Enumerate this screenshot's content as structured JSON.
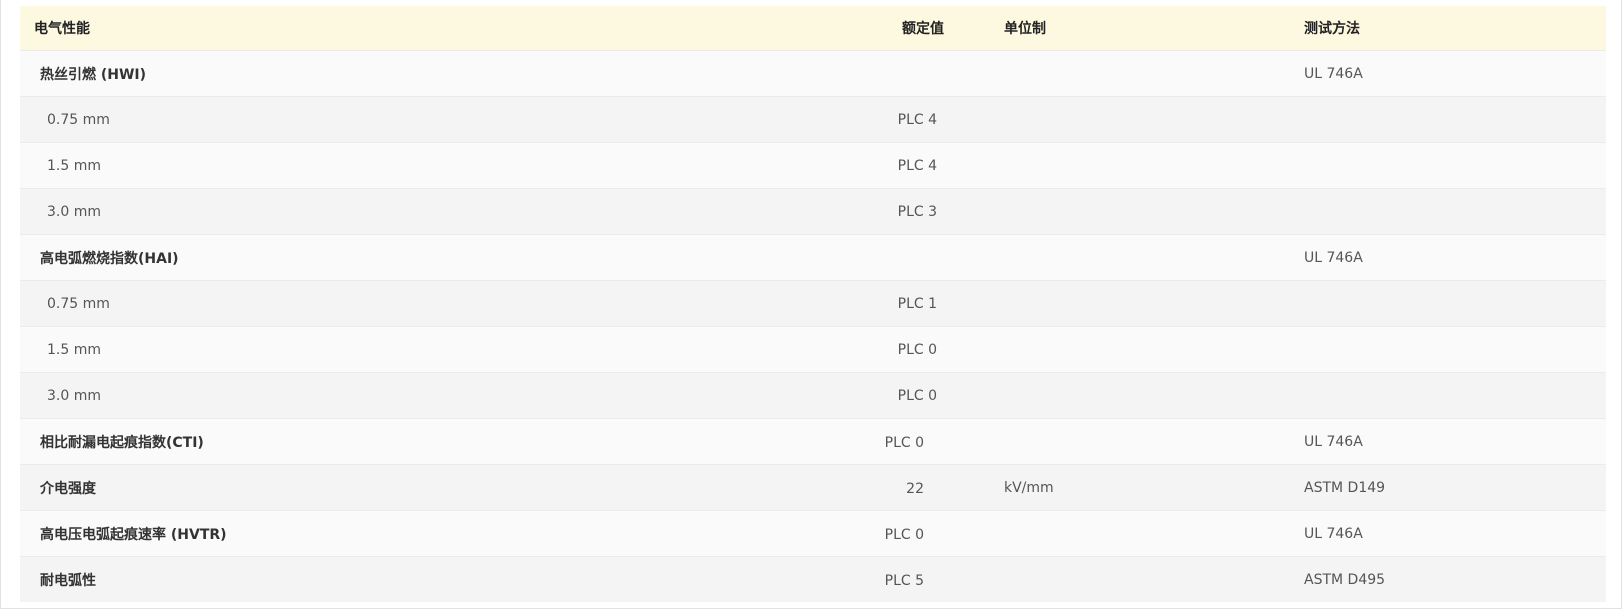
{
  "table": {
    "headers": {
      "property": "电气性能",
      "value": "额定值",
      "unit": "单位制",
      "method": "测试方法"
    },
    "rows": [
      {
        "property": "热丝引燃 (HWI)",
        "value": "",
        "unit": "",
        "method": "UL 746A",
        "type": "group"
      },
      {
        "property": "0.75 mm",
        "value": "PLC 4",
        "unit": "",
        "method": "",
        "type": "sub"
      },
      {
        "property": "1.5 mm",
        "value": "PLC 4",
        "unit": "",
        "method": "",
        "type": "sub"
      },
      {
        "property": "3.0 mm",
        "value": "PLC 3",
        "unit": "",
        "method": "",
        "type": "sub"
      },
      {
        "property": "高电弧燃烧指数(HAI)",
        "value": "",
        "unit": "",
        "method": "UL 746A",
        "type": "group"
      },
      {
        "property": "0.75 mm",
        "value": "PLC 1",
        "unit": "",
        "method": "",
        "type": "sub"
      },
      {
        "property": "1.5 mm",
        "value": "PLC 0",
        "unit": "",
        "method": "",
        "type": "sub"
      },
      {
        "property": "3.0 mm",
        "value": "PLC 0",
        "unit": "",
        "method": "",
        "type": "sub"
      },
      {
        "property": "相比耐漏电起痕指数(CTI)",
        "value": "PLC 0",
        "unit": "",
        "method": "UL 746A",
        "type": "group"
      },
      {
        "property": "介电强度",
        "value": "22",
        "unit": "kV/mm",
        "method": "ASTM D149",
        "type": "group"
      },
      {
        "property": "高电压电弧起痕速率 (HVTR)",
        "value": "PLC 0",
        "unit": "",
        "method": "UL 746A",
        "type": "group"
      },
      {
        "property": "耐电弧性",
        "value": "PLC 5",
        "unit": "",
        "method": "ASTM D495",
        "type": "group"
      }
    ]
  }
}
